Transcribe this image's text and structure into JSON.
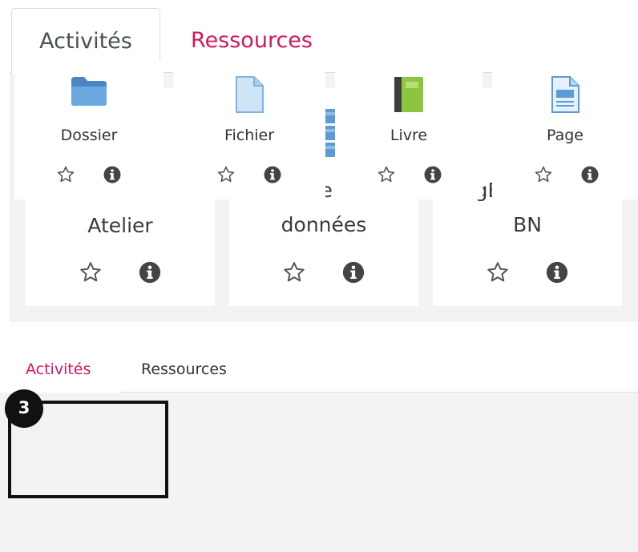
{
  "top_chooser": {
    "tabs": [
      {
        "label": "Activités",
        "active": true
      },
      {
        "label": "Ressources",
        "active": false
      }
    ],
    "cards": [
      {
        "label": "Atelier",
        "label_line2": "",
        "icon": "workshop-people-icon"
      },
      {
        "label": "Base de",
        "label_line2": "données",
        "icon": "database-icon"
      },
      {
        "label": "BigBlueButton",
        "label_line2": "BN",
        "icon": "bigbluebutton-icon"
      }
    ]
  },
  "bottom_chooser": {
    "tabs": [
      {
        "label": "Activités",
        "active": true
      },
      {
        "label": "Ressources",
        "active": false
      }
    ],
    "cards": [
      {
        "label": "Dossier",
        "icon": "folder-icon"
      },
      {
        "label": "Fichier",
        "icon": "file-icon"
      },
      {
        "label": "Livre",
        "icon": "book-icon"
      },
      {
        "label": "Page",
        "icon": "page-icon"
      }
    ],
    "step_badge": "3"
  },
  "colors": {
    "accent": "#d2185e",
    "panel_bg": "#f3f3f3",
    "folder": "#5b9bd8",
    "book": "#8cc63f",
    "bbb": "#333333"
  }
}
